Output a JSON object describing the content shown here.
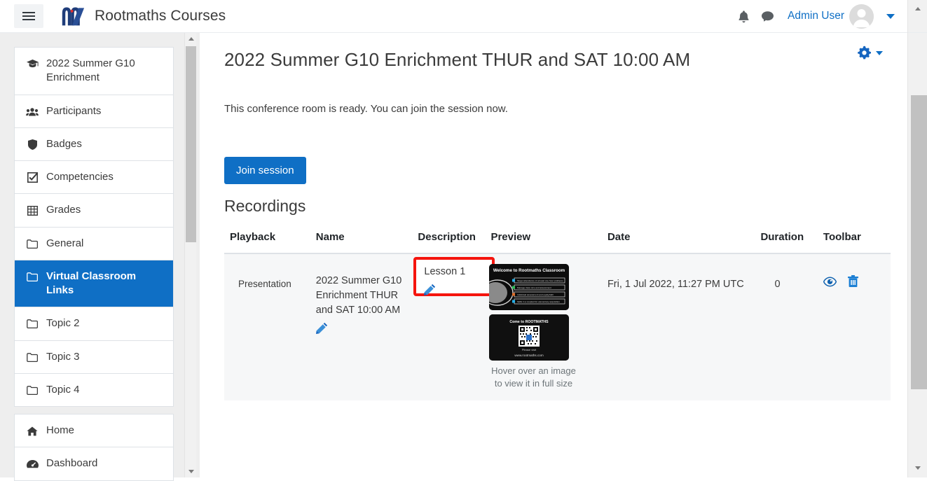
{
  "navbar": {
    "menu_toggle_label": "Toggle menu",
    "brand_title": "Rootmaths Courses",
    "notifications_icon": "bell-icon",
    "messages_icon": "message-icon",
    "user_name": "Admin User",
    "avatar_icon": "user-avatar-icon",
    "dropdown_icon": "caret-down-icon"
  },
  "sidebar": {
    "group1": [
      {
        "label": "2022 Summer G10 Enrichment",
        "icon": "graduation-cap-icon",
        "active": false
      },
      {
        "label": "Participants",
        "icon": "users-icon",
        "active": false
      },
      {
        "label": "Badges",
        "icon": "shield-icon",
        "active": false
      },
      {
        "label": "Competencies",
        "icon": "checkbox-icon",
        "active": false
      },
      {
        "label": "Grades",
        "icon": "table-icon",
        "active": false
      },
      {
        "label": "General",
        "icon": "folder-icon",
        "active": false
      },
      {
        "label": "Virtual Classroom Links",
        "icon": "folder-icon",
        "active": true
      },
      {
        "label": "Topic 2",
        "icon": "folder-icon",
        "active": false
      },
      {
        "label": "Topic 3",
        "icon": "folder-icon",
        "active": false
      },
      {
        "label": "Topic 4",
        "icon": "folder-icon",
        "active": false
      }
    ],
    "group2": [
      {
        "label": "Home",
        "icon": "home-icon",
        "active": false
      },
      {
        "label": "Dashboard",
        "icon": "dashboard-icon",
        "active": false
      }
    ]
  },
  "main": {
    "page_title": "2022 Summer G10 Enrichment THUR and SAT 10:00 AM",
    "settings_icon": "gear-icon",
    "intro_text": "This conference room is ready. You can join the session now.",
    "join_button_label": "Join session",
    "recordings_heading": "Recordings"
  },
  "table": {
    "headers": {
      "playback": "Playback",
      "name": "Name",
      "description": "Description",
      "preview": "Preview",
      "date": "Date",
      "duration": "Duration",
      "toolbar": "Toolbar"
    },
    "rows": [
      {
        "playback": "Presentation",
        "name": "2022 Summer G10 Enrichment THUR and SAT 10:00 AM",
        "name_edit_icon": "pencil-icon",
        "description": "Lesson 1",
        "description_edit_icon": "pencil-icon",
        "description_highlighted": true,
        "preview_hint": "Hover over an image to view it in full size",
        "preview_thumbs": [
          {
            "title": "Welcome to Rootmaths Classroom",
            "alt": "slide-thumbnail-welcome"
          },
          {
            "title": "Come to ROOTMATHS",
            "subtitle": "Please visit",
            "url": "www.rootmaths.com",
            "alt": "slide-thumbnail-qr"
          }
        ],
        "date": "Fri, 1 Jul 2022, 11:27 PM UTC",
        "duration": "0",
        "toolbar_icons": [
          {
            "name": "eye-icon",
            "title": "Show"
          },
          {
            "name": "trash-icon",
            "title": "Delete"
          }
        ]
      }
    ]
  },
  "colors": {
    "brand_blue": "#0f6fc5",
    "logo_navy": "#1f3d7a",
    "logo_dot_red": "#e03030",
    "highlight_red": "#f5150e",
    "row_bg": "#f6f7f8",
    "page_bg": "#eeeeee"
  },
  "scrollbars": {
    "drawer_scrollbar": "drawer-vertical-scrollbar",
    "page_scrollbar": "page-vertical-scrollbar"
  }
}
